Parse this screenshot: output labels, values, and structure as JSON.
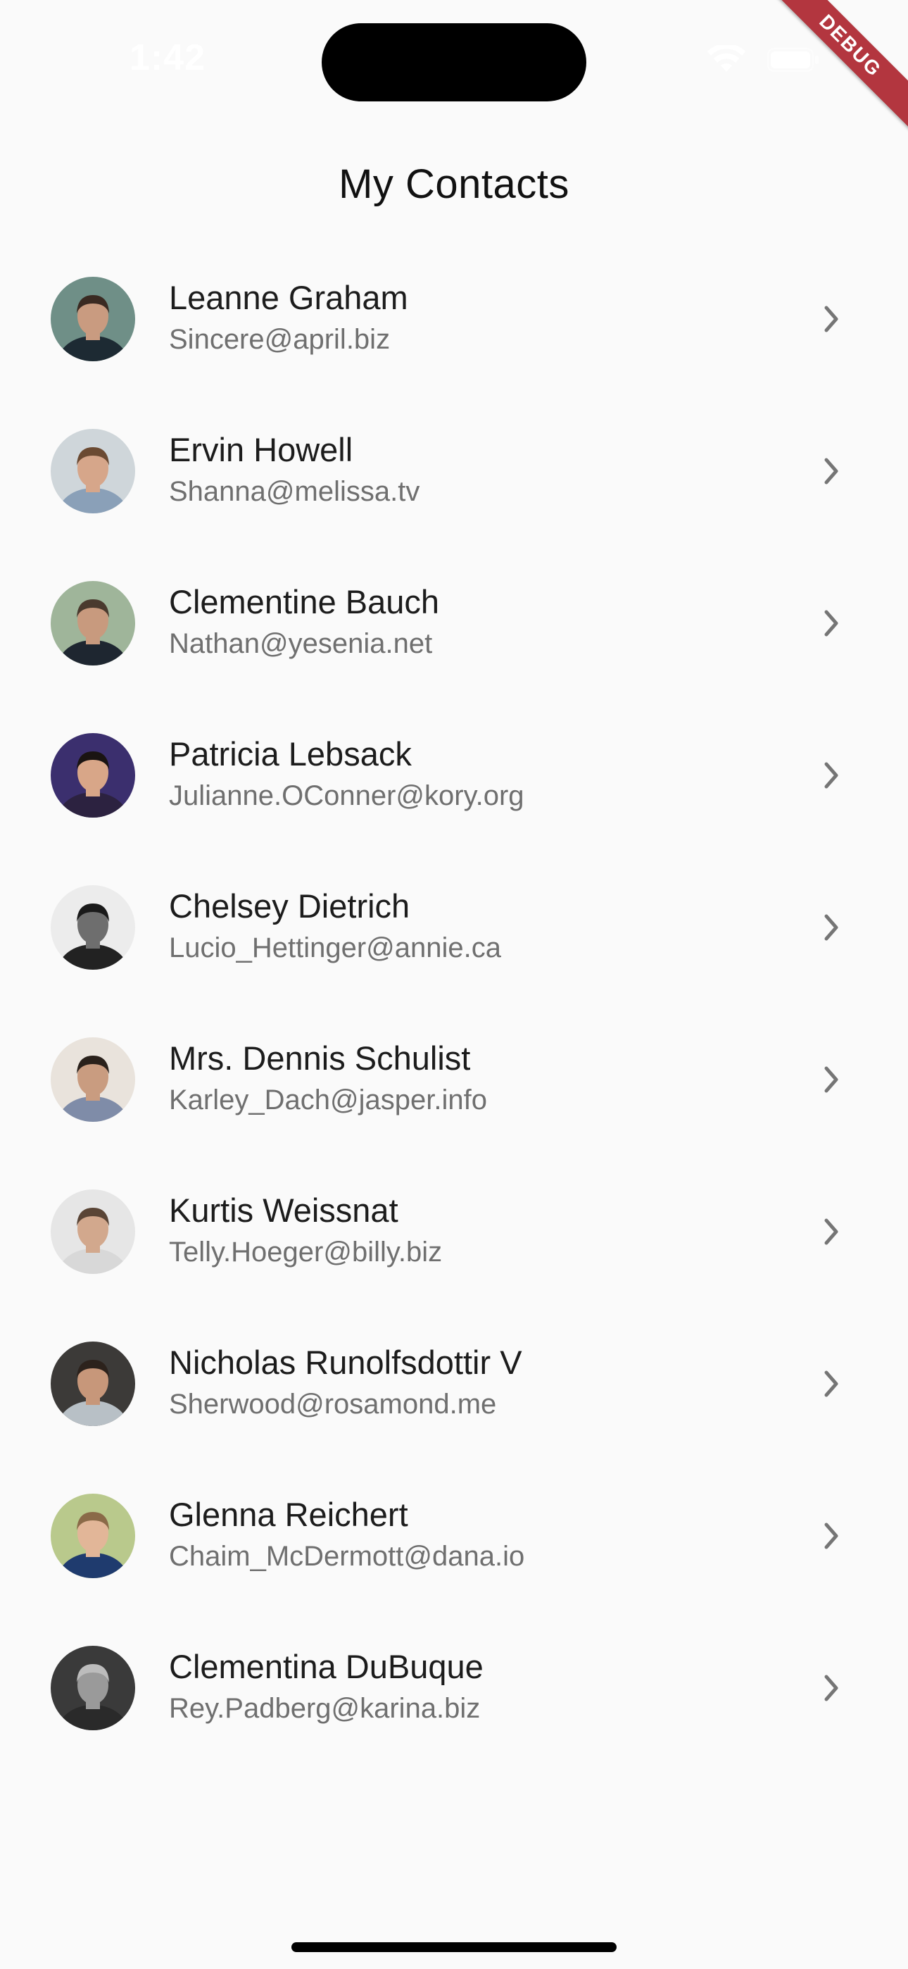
{
  "status_bar": {
    "time": "1:42",
    "icons": [
      "wifi-icon",
      "battery-icon"
    ]
  },
  "debug_banner": {
    "label": "DEBUG",
    "color": "#b3363f"
  },
  "header": {
    "title": "My Contacts"
  },
  "contacts": [
    {
      "name": "Leanne Graham",
      "email": "Sincere@april.biz",
      "avatar_colors": [
        "#6f8f87",
        "#3a2a22",
        "#c99b80",
        "#1d2a33"
      ]
    },
    {
      "name": "Ervin Howell",
      "email": "Shanna@melissa.tv",
      "avatar_colors": [
        "#cfd6da",
        "#6b4a32",
        "#d6a68a",
        "#8aa0b8"
      ]
    },
    {
      "name": "Clementine Bauch",
      "email": "Nathan@yesenia.net",
      "avatar_colors": [
        "#9fb59a",
        "#4a3a2e",
        "#c89a7e",
        "#1e2630"
      ]
    },
    {
      "name": "Patricia Lebsack",
      "email": "Julianne.OConner@kory.org",
      "avatar_colors": [
        "#3b2f6e",
        "#1a1412",
        "#d8a688",
        "#2c2240"
      ]
    },
    {
      "name": "Chelsey Dietrich",
      "email": "Lucio_Hettinger@annie.ca",
      "avatar_colors": [
        "#ececec",
        "#1a1a1a",
        "#6e6e6e",
        "#222222"
      ]
    },
    {
      "name": "Mrs. Dennis Schulist",
      "email": "Karley_Dach@jasper.info",
      "avatar_colors": [
        "#e9e3dc",
        "#2a211b",
        "#c99c80",
        "#7f8ca8"
      ]
    },
    {
      "name": "Kurtis Weissnat",
      "email": "Telly.Hoeger@billy.biz",
      "avatar_colors": [
        "#e6e6e6",
        "#5a4536",
        "#d2a88d",
        "#d8d8d8"
      ]
    },
    {
      "name": "Nicholas Runolfsdottir V",
      "email": "Sherwood@rosamond.me",
      "avatar_colors": [
        "#3c3a38",
        "#2c221c",
        "#c7977a",
        "#b8c0c6"
      ]
    },
    {
      "name": "Glenna Reichert",
      "email": "Chaim_McDermott@dana.io",
      "avatar_colors": [
        "#b9c98c",
        "#8a6a48",
        "#e2b698",
        "#1f3b6e"
      ]
    },
    {
      "name": "Clementina DuBuque",
      "email": "Rey.Padberg@karina.biz",
      "avatar_colors": [
        "#3a3a3a",
        "#bcbcbc",
        "#9a9a9a",
        "#2a2a2a"
      ]
    }
  ]
}
